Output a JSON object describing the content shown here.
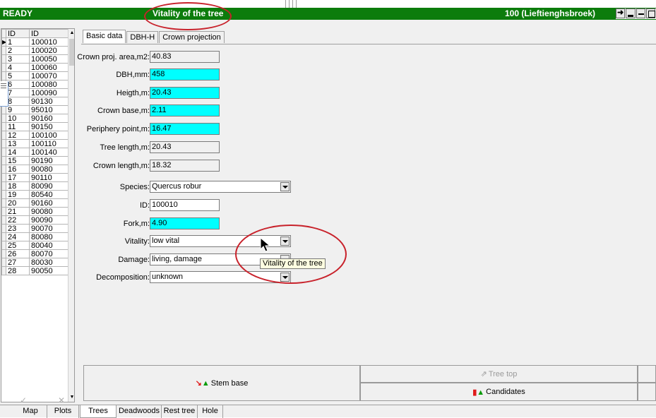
{
  "status": {
    "left": "READY",
    "center": "Vitality of the tree",
    "right": "100 (Lieftienghsbroek)"
  },
  "grid": {
    "headers": [
      "ID",
      "ID"
    ],
    "rows": [
      [
        "1",
        "100010"
      ],
      [
        "2",
        "100020"
      ],
      [
        "3",
        "100050"
      ],
      [
        "4",
        "100060"
      ],
      [
        "5",
        "100070"
      ],
      [
        "6",
        "100080"
      ],
      [
        "7",
        "100090"
      ],
      [
        "8",
        "90130"
      ],
      [
        "9",
        "95010"
      ],
      [
        "10",
        "90160"
      ],
      [
        "11",
        "90150"
      ],
      [
        "12",
        "100100"
      ],
      [
        "13",
        "100110"
      ],
      [
        "14",
        "100140"
      ],
      [
        "15",
        "90190"
      ],
      [
        "16",
        "90080"
      ],
      [
        "17",
        "90110"
      ],
      [
        "18",
        "80090"
      ],
      [
        "19",
        "80540"
      ],
      [
        "20",
        "90160"
      ],
      [
        "21",
        "90080"
      ],
      [
        "22",
        "90090"
      ],
      [
        "23",
        "90070"
      ],
      [
        "24",
        "80080"
      ],
      [
        "25",
        "80040"
      ],
      [
        "26",
        "80070"
      ],
      [
        "27",
        "80030"
      ],
      [
        "28",
        "90050"
      ]
    ]
  },
  "tabs": [
    "Basic data",
    "DBH-H",
    "Crown projection"
  ],
  "form": {
    "crown_proj_area": {
      "label": "Crown proj. area,m2:",
      "value": "40.83"
    },
    "dbh": {
      "label": "DBH,mm:",
      "value": "458"
    },
    "height": {
      "label": "Heigth,m:",
      "value": "20.43"
    },
    "crown_base": {
      "label": "Crown base,m:",
      "value": "2.11"
    },
    "periphery": {
      "label": "Periphery point,m:",
      "value": "16.47"
    },
    "tree_length": {
      "label": "Tree length,m:",
      "value": "20.43"
    },
    "crown_length": {
      "label": "Crown length,m:",
      "value": "18.32"
    },
    "species": {
      "label": "Species:",
      "value": "Quercus robur"
    },
    "id": {
      "label": "ID:",
      "value": "100010"
    },
    "fork": {
      "label": "Fork,m:",
      "value": "4.90"
    },
    "vitality": {
      "label": "Vitality:",
      "value": "low vital"
    },
    "damage": {
      "label": "Damage:",
      "value": "living, damage"
    },
    "decomposition": {
      "label": "Decomposition:",
      "value": "unknown"
    }
  },
  "tooltip": "Vitality of the tree",
  "buttons": {
    "stem_base": "Stem base",
    "tree_top": "Tree top",
    "candidates": "Candidates"
  },
  "bottom_tabs": [
    "Map",
    "Plots",
    "Trees",
    "Deadwoods",
    "Rest tree",
    "Hole"
  ],
  "colors": {
    "status_green": "#0c7c0c",
    "highlight_cyan": "#00ffff",
    "annotation_red": "#c8222b"
  }
}
